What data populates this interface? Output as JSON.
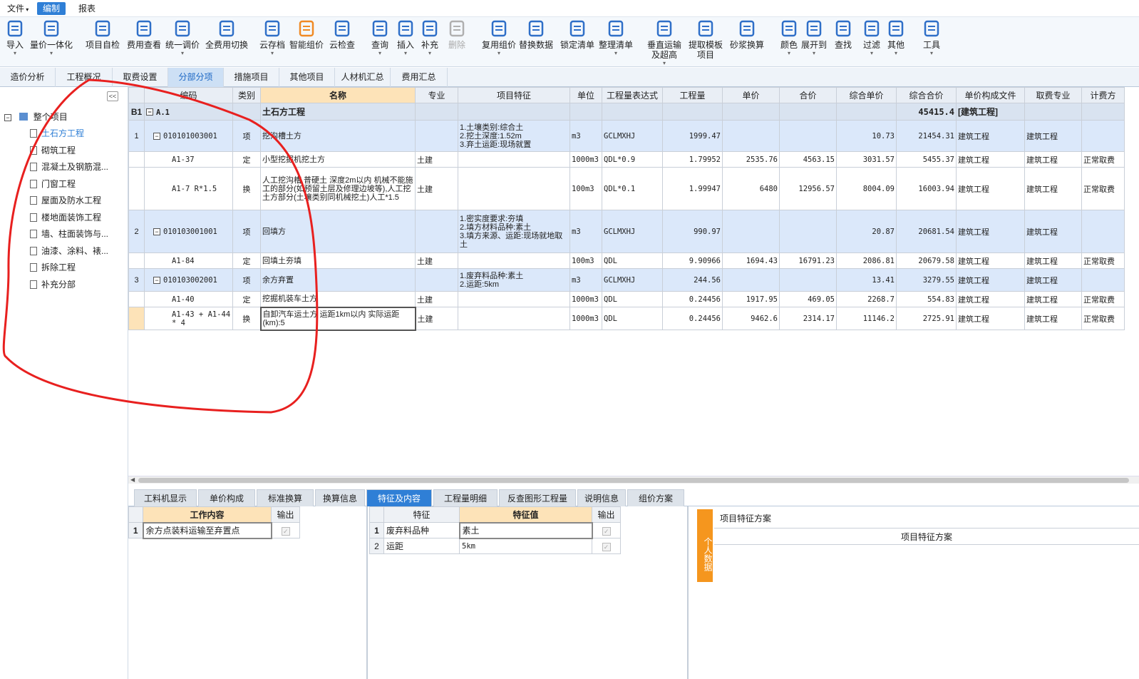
{
  "menu": {
    "file": "文件",
    "edit": "编制",
    "report": "报表"
  },
  "ribbon": [
    {
      "label": "导入",
      "icon": "import-icon",
      "dd": true
    },
    {
      "label": "量价一体化",
      "icon": "qty-price-icon",
      "dd": true
    },
    {
      "label": "项目自检",
      "icon": "self-check-icon",
      "dd": false
    },
    {
      "label": "费用查看",
      "icon": "fee-view-icon",
      "dd": false
    },
    {
      "label": "统一调价",
      "icon": "adjust-price-icon",
      "dd": true
    },
    {
      "label": "全费用切换",
      "icon": "full-fee-switch-icon",
      "dd": false
    },
    {
      "label": "云存档",
      "icon": "cloud-save-icon",
      "dd": true
    },
    {
      "label": "智能组价",
      "icon": "smart-price-icon",
      "dd": false
    },
    {
      "label": "云检查",
      "icon": "cloud-check-icon",
      "dd": false
    },
    {
      "label": "查询",
      "icon": "query-icon",
      "dd": true
    },
    {
      "label": "插入",
      "icon": "insert-icon",
      "dd": true
    },
    {
      "label": "补充",
      "icon": "supplement-icon",
      "dd": true
    },
    {
      "label": "删除",
      "icon": "delete-icon",
      "dd": false
    },
    {
      "label": "复用组价",
      "icon": "reuse-price-icon",
      "dd": true
    },
    {
      "label": "替换数据",
      "icon": "replace-data-icon",
      "dd": false
    },
    {
      "label": "锁定清单",
      "icon": "lock-list-icon",
      "dd": false
    },
    {
      "label": "整理清单",
      "icon": "organize-list-icon",
      "dd": true
    },
    {
      "label": "垂直运输\n及超高",
      "icon": "vertical-transport-icon",
      "dd": true
    },
    {
      "label": "提取模板\n项目",
      "icon": "template-icon",
      "dd": false
    },
    {
      "label": "砂浆换算",
      "icon": "mortar-convert-icon",
      "dd": false
    },
    {
      "label": "颜色",
      "icon": "color-icon",
      "dd": true
    },
    {
      "label": "展开到",
      "icon": "expand-to-icon",
      "dd": true
    },
    {
      "label": "查找",
      "icon": "find-icon",
      "dd": false
    },
    {
      "label": "过滤",
      "icon": "filter-icon",
      "dd": true
    },
    {
      "label": "其他",
      "icon": "other-icon",
      "dd": true
    },
    {
      "label": "工具",
      "icon": "tools-icon",
      "dd": true
    }
  ],
  "tabs": [
    "造价分析",
    "工程概况",
    "取费设置",
    "分部分项",
    "措施项目",
    "其他项目",
    "人材机汇总",
    "费用汇总"
  ],
  "tree": {
    "root": "整个项目",
    "items": [
      "土石方工程",
      "砌筑工程",
      "混凝土及钢筋混...",
      "门窗工程",
      "屋面及防水工程",
      "楼地面装饰工程",
      "墙、柱面装饰与...",
      "油漆、涂料、裱...",
      "拆除工程",
      "补充分部"
    ]
  },
  "grid": {
    "headers": [
      "",
      "编码",
      "类别",
      "名称",
      "专业",
      "项目特征",
      "单位",
      "工程量表达式",
      "工程量",
      "单价",
      "合价",
      "综合单价",
      "综合合价",
      "单价构成文件",
      "取费专业",
      "计费方"
    ],
    "rows": [
      [
        "B1",
        "A.1",
        "",
        "土石方工程",
        "",
        "",
        "",
        "",
        "",
        "",
        "",
        "",
        "45415.4",
        "[建筑工程]",
        "",
        ""
      ],
      [
        "1",
        "010101003001",
        "项",
        "挖沟槽土方",
        "",
        "1.土壤类别:综合土\n2.挖土深度:1.52m\n3.弃土运距:现场就置",
        "m3",
        "GCLMXHJ",
        "1999.47",
        "",
        "",
        "10.73",
        "21454.31",
        "建筑工程",
        "建筑工程",
        ""
      ],
      [
        "",
        "A1-37",
        "定",
        "小型挖掘机挖土方",
        "土建",
        "",
        "1000m3",
        "QDL*0.9",
        "1.79952",
        "2535.76",
        "4563.15",
        "3031.57",
        "5455.37",
        "建筑工程",
        "建筑工程",
        "正常取费"
      ],
      [
        "",
        "A1-7 R*1.5",
        "换",
        "人工挖沟槽 普硬土 深度2m以内  机械不能施工的部分(如预留土层及修理边坡等),人工挖土方部分(土壤类别同机械挖土)人工*1.5",
        "土建",
        "",
        "100m3",
        "QDL*0.1",
        "1.99947",
        "6480",
        "12956.57",
        "8004.09",
        "16003.94",
        "建筑工程",
        "建筑工程",
        "正常取费"
      ],
      [
        "2",
        "010103001001",
        "项",
        "回填方",
        "",
        "1.密实度要求:夯填\n2.填方材料品种:素土\n3.填方来源、运距:现场就地取土",
        "m3",
        "GCLMXHJ",
        "990.97",
        "",
        "",
        "20.87",
        "20681.54",
        "建筑工程",
        "建筑工程",
        ""
      ],
      [
        "",
        "A1-84",
        "定",
        "回填土夯填",
        "土建",
        "",
        "100m3",
        "QDL",
        "9.90966",
        "1694.43",
        "16791.23",
        "2086.81",
        "20679.58",
        "建筑工程",
        "建筑工程",
        "正常取费"
      ],
      [
        "3",
        "010103002001",
        "项",
        "余方弃置",
        "",
        "1.废弃料品种:素土\n2.运距:5km",
        "m3",
        "GCLMXHJ",
        "244.56",
        "",
        "",
        "13.41",
        "3279.55",
        "建筑工程",
        "建筑工程",
        ""
      ],
      [
        "",
        "A1-40",
        "定",
        "挖掘机装车土方",
        "土建",
        "",
        "1000m3",
        "QDL",
        "0.24456",
        "1917.95",
        "469.05",
        "2268.7",
        "554.83",
        "建筑工程",
        "建筑工程",
        "正常取费"
      ],
      [
        "",
        "A1-43 + A1-44 * 4",
        "换",
        "自卸汽车运土方 运距1km以内  实际运距(km):5",
        "土建",
        "",
        "1000m3",
        "QDL",
        "0.24456",
        "9462.6",
        "2314.17",
        "11146.2",
        "2725.91",
        "建筑工程",
        "建筑工程",
        "正常取费"
      ]
    ]
  },
  "bottom_tabs": [
    "工料机显示",
    "单价构成",
    "标准换算",
    "换算信息",
    "特征及内容",
    "工程量明细",
    "反查图形工程量",
    "说明信息",
    "组价方案"
  ],
  "work": {
    "h_content": "工作内容",
    "h_output": "输出",
    "rows": [
      {
        "idx": "1",
        "content": "余方点装料运输至弃置点"
      }
    ]
  },
  "features": {
    "h_feature": "特征",
    "h_value": "特征值",
    "h_output": "输出",
    "rows": [
      {
        "idx": "1",
        "feature": "废弃料品种",
        "value": "素土"
      },
      {
        "idx": "2",
        "feature": "运距",
        "value": "5km"
      }
    ]
  },
  "scheme": {
    "side_tag": "个人数据",
    "title": "项目特征方案",
    "header": "项目特征方案"
  },
  "colors": {
    "accent": "#2f7fd6",
    "annotation": "#e8201f",
    "side_tag": "#f5961e"
  }
}
